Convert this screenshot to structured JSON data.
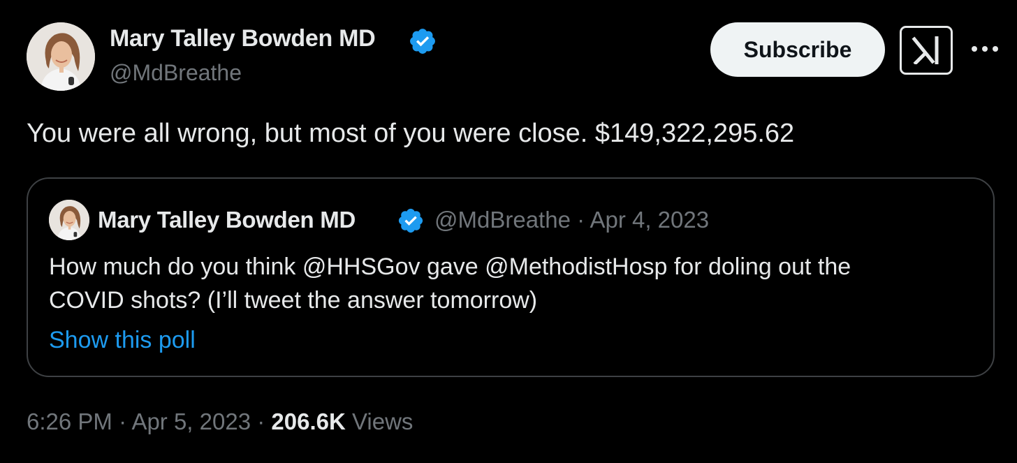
{
  "tweet": {
    "author": {
      "name": "Mary Talley Bowden MD",
      "handle": "@MdBreathe",
      "verified_icon": "verified-badge-icon",
      "avatar_icon": "avatar-photo"
    },
    "actions": {
      "subscribe_label": "Subscribe",
      "grok_icon": "grok-icon",
      "more_icon": "more-options-icon"
    },
    "text": "You were all wrong, but most of you were close. $149,322,295.62",
    "quote": {
      "author_name": "Mary Talley Bowden MD",
      "handle": "@MdBreathe",
      "separator": "·",
      "date": "Apr 4, 2023",
      "text_line1": "How much do you think @HHSGov gave @MethodistHosp for doling out the",
      "text_line2": "COVID shots?  (I’ll tweet the answer tomorrow)",
      "poll_link": "Show this poll"
    },
    "meta": {
      "time": "6:26 PM",
      "separator": "·",
      "date": "Apr 5, 2023",
      "views_count": "206.6K",
      "views_label": "Views"
    }
  },
  "colors": {
    "background": "#000000",
    "text_primary": "#e7e9ea",
    "text_secondary": "#71767b",
    "link": "#1d9bf0",
    "verified": "#1d9bf0",
    "border": "#3e4144",
    "subscribe_bg": "#eff3f4"
  }
}
